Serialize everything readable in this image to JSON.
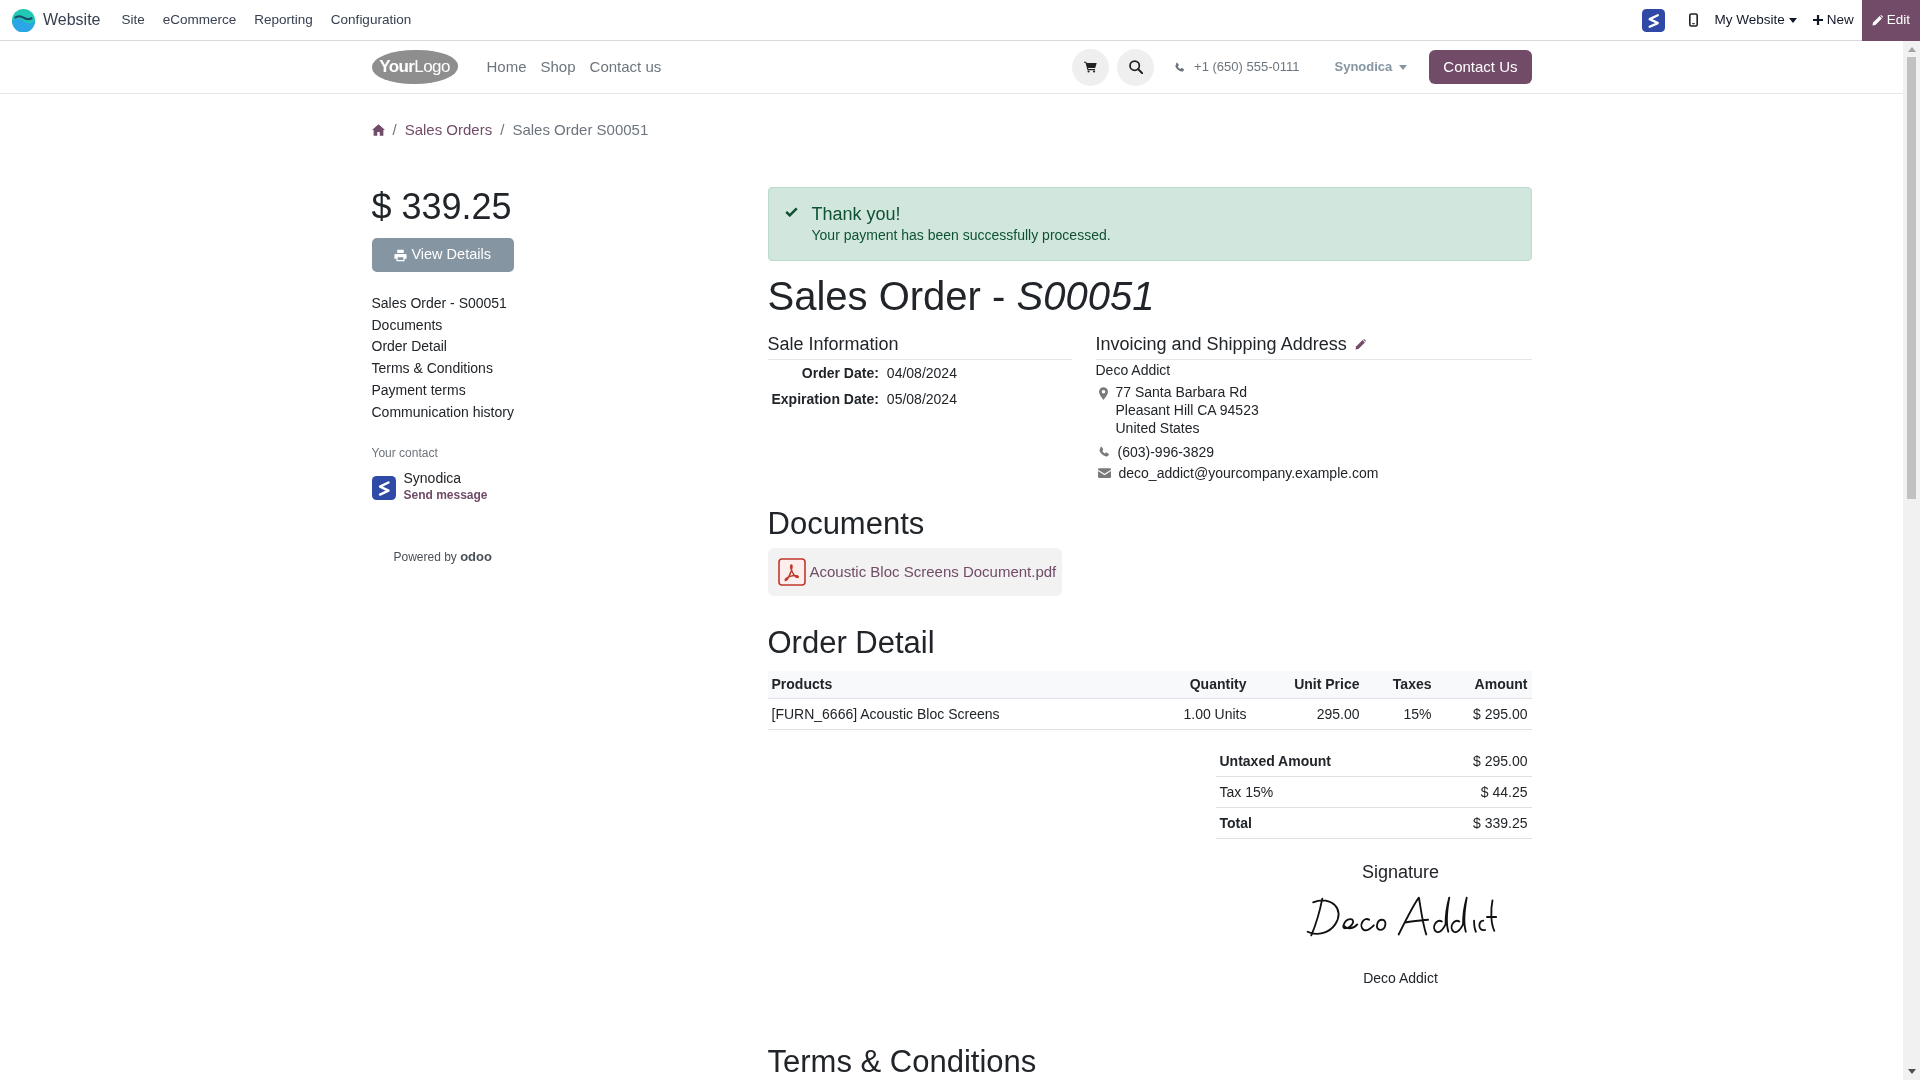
{
  "admin_bar": {
    "app_name": "Website",
    "menu": [
      "Site",
      "eCommerce",
      "Reporting",
      "Configuration"
    ],
    "website_switcher": "My Website",
    "new_button": "New",
    "edit_button": "Edit"
  },
  "header": {
    "logo": "**Your**Logo",
    "nav": [
      "Home",
      "Shop",
      "Contact us"
    ],
    "phone": "+1 (650) 555-0111",
    "user_menu": "Synodica",
    "cta_button": "Contact Us"
  },
  "breadcrumb": {
    "separator": "/",
    "items": [
      {
        "label": "Sales Orders",
        "active": false
      },
      {
        "label": "Sales Order S00051",
        "active": true
      }
    ]
  },
  "sidebar": {
    "amount": "$ 339.25",
    "view_button": "View Details",
    "toc": [
      "Sales Order - S00051",
      "Documents",
      "Order Detail",
      "Terms & Conditions",
      "Payment terms",
      "Communication history"
    ],
    "contact_label": "Your contact",
    "contact_name": "Synodica",
    "contact_action": "Send message",
    "powered_by": "Powered by",
    "powered_brand": "odoo"
  },
  "alert": {
    "title": "Thank you!",
    "message": "Your payment has been successfully processed."
  },
  "title": "Sales Order - *S00051*",
  "sale_information": {
    "heading": "Sale Information",
    "fields": [
      {
        "label": "Order Date:",
        "value": "04/08/2024"
      },
      {
        "label": "Expiration Date:",
        "value": "05/08/2024"
      }
    ]
  },
  "address": {
    "heading": "Invoicing and Shipping Address",
    "name": "Deco Addict",
    "street_lines": [
      "77 Santa Barbara Rd",
      "Pleasant Hill CA 94523",
      "United States"
    ],
    "phone": "(603)-996-3829",
    "email": "deco_addict@yourcompany.example.com"
  },
  "documents": {
    "heading": "Documents",
    "files": [
      "Acoustic Bloc Screens Document.pdf"
    ]
  },
  "order_detail": {
    "heading": "Order Detail",
    "columns": [
      "Products",
      "Quantity",
      "Unit Price",
      "Taxes",
      "Amount"
    ],
    "rows": [
      [
        "[FURN_6666] Acoustic Bloc Screens",
        "1.00 Units",
        "295.00",
        "15%",
        "$ 295.00"
      ]
    ],
    "totals": [
      {
        "kind": "subtotal",
        "label": "Untaxed Amount",
        "value": "$ 295.00"
      },
      {
        "kind": "tax",
        "label": "Tax 15%",
        "value": "$ 44.25"
      },
      {
        "kind": "total",
        "label": "Total",
        "value": "$ 339.25"
      }
    ]
  },
  "signature": {
    "heading": "Signature",
    "name": "Deco Addict"
  },
  "terms": {
    "heading": "Terms & Conditions"
  }
}
